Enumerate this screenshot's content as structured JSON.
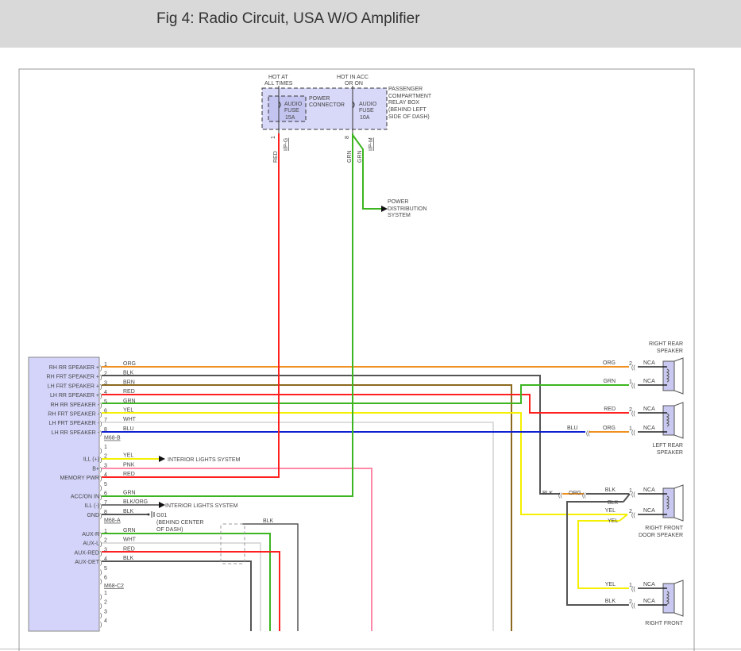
{
  "header": {
    "title": "Fig 4: Radio Circuit, USA W/O Amplifier"
  },
  "relay_box": {
    "hot_at_all_times": [
      "HOT AT",
      "ALL TIMES"
    ],
    "hot_in_acc": [
      "HOT IN ACC",
      "OR ON"
    ],
    "power_connector": [
      "POWER",
      "CONNECTOR"
    ],
    "fuse1": [
      "AUDIO",
      "FUSE",
      "15A"
    ],
    "fuse2": [
      "AUDIO",
      "FUSE",
      "10A"
    ],
    "box_label": [
      "PASSENGER",
      "COMPARTMENT",
      "RELAY BOX",
      "(BEHIND LEFT",
      "SIDE OF DASH)"
    ],
    "pin_left": "1",
    "pin_right": "8",
    "conn_left": "I/P-G",
    "conn_right": "I/P-M",
    "wire_left": "RED",
    "wire_right_a": "GRN",
    "wire_right_b": "GRN"
  },
  "power_distribution": [
    "POWER",
    "DISTRIBUTION",
    "SYSTEM"
  ],
  "connectors": [
    {
      "name": "M68-B",
      "rows": [
        {
          "pin": "1",
          "label": "RH RR SPEAKER +",
          "wire": "ORG"
        },
        {
          "pin": "2",
          "label": "RH FRT SPEAKER +",
          "wire": "BLK"
        },
        {
          "pin": "3",
          "label": "LH FRT SPEAKER +",
          "wire": "BRN"
        },
        {
          "pin": "4",
          "label": "LH RR SPEAKER +",
          "wire": "RED"
        },
        {
          "pin": "5",
          "label": "RH RR SPEAKER -",
          "wire": "GRN"
        },
        {
          "pin": "6",
          "label": "RH FRT SPEAKER -",
          "wire": "YEL"
        },
        {
          "pin": "7",
          "label": "LH FRT SPEAKER -",
          "wire": "WHT"
        },
        {
          "pin": "8",
          "label": "LH RR SPEAKER -",
          "wire": "BLU"
        }
      ]
    },
    {
      "name": "M68-A",
      "rows": [
        {
          "pin": "1",
          "label": "",
          "wire": ""
        },
        {
          "pin": "2",
          "label": "ILL (+)",
          "wire": "YEL"
        },
        {
          "pin": "3",
          "label": "B+",
          "wire": "PNK"
        },
        {
          "pin": "4",
          "label": "MEMORY PWR",
          "wire": "RED"
        },
        {
          "pin": "5",
          "label": "",
          "wire": ""
        },
        {
          "pin": "6",
          "label": "ACC/ON IN",
          "wire": "GRN"
        },
        {
          "pin": "7",
          "label": "ILL (-)",
          "wire": "BLK/ORG"
        },
        {
          "pin": "8",
          "label": "GND",
          "wire": "BLK"
        }
      ]
    },
    {
      "name": "M68-C2",
      "rows": [
        {
          "pin": "1",
          "label": "AUX-R",
          "wire": "GRN"
        },
        {
          "pin": "2",
          "label": "AUX-L",
          "wire": "WHT"
        },
        {
          "pin": "3",
          "label": "AUX-RED",
          "wire": "RED"
        },
        {
          "pin": "4",
          "label": "AUX-DET",
          "wire": "BLK"
        },
        {
          "pin": "5",
          "label": "",
          "wire": ""
        },
        {
          "pin": "6",
          "label": "",
          "wire": ""
        }
      ]
    },
    {
      "name": "",
      "rows": [
        {
          "pin": "1",
          "label": "",
          "wire": ""
        },
        {
          "pin": "2",
          "label": "",
          "wire": ""
        },
        {
          "pin": "3",
          "label": "",
          "wire": ""
        },
        {
          "pin": "4",
          "label": "",
          "wire": ""
        }
      ]
    }
  ],
  "interior_lights_1": "INTERIOR LIGHTS SYSTEM",
  "interior_lights_2": "INTERIOR LIGHTS SYSTEM",
  "ground": [
    "G01",
    "(BEHIND CENTER",
    "OF DASH)"
  ],
  "aux_shield_wire": "BLK",
  "speakers": {
    "right_rear": {
      "name": [
        "RIGHT REAR",
        "SPEAKER"
      ],
      "pins": [
        {
          "pin": "2",
          "nca": "NCA",
          "wire": "ORG"
        },
        {
          "pin": "1",
          "nca": "NCA",
          "wire": "GRN"
        }
      ]
    },
    "left_rear": {
      "name": [
        "LEFT REAR",
        "SPEAKER"
      ],
      "pins": [
        {
          "pin": "2",
          "nca": "NCA",
          "wire": "RED"
        },
        {
          "pin": "1",
          "nca": "NCA",
          "wire": "ORG"
        }
      ],
      "inline_wire": "BLU"
    },
    "right_front_door": {
      "name": [
        "RIGHT FRONT",
        "DOOR SPEAKER"
      ],
      "pins": [
        {
          "pin": "1",
          "nca": "NCA",
          "wire": "BLK"
        },
        {
          "pin": "2",
          "nca": "NCA",
          "wire": "YEL"
        }
      ],
      "inline_a": "BLK",
      "inline_b": "ORG",
      "branch_a": "BLK",
      "branch_b": "YEL"
    },
    "right_front": {
      "name": [
        "RIGHT FRONT"
      ],
      "pins": [
        {
          "pin": "1",
          "nca": "NCA",
          "wire": "YEL"
        },
        {
          "pin": "2",
          "nca": "NCA",
          "wire": "BLK"
        }
      ]
    }
  },
  "wire_colors": {
    "ORG": "#f0901e",
    "BLK": "#555555",
    "BRN": "#8b6a1e",
    "RED": "#ff2020",
    "GRN": "#3cb521",
    "YEL": "#f4f000",
    "WHT": "#dddddd",
    "BLU": "#1020d0",
    "PNK": "#ff88a8"
  }
}
